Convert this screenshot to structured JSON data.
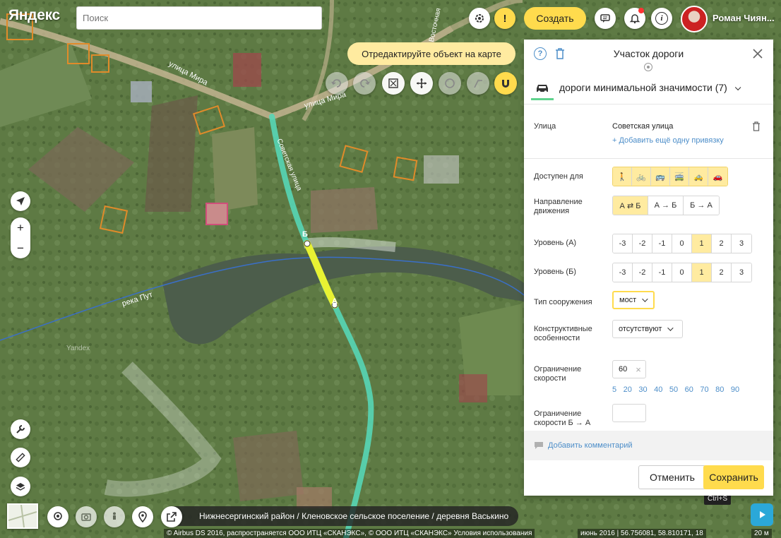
{
  "brand": {
    "logo": "Яндекс"
  },
  "search": {
    "placeholder": "Поиск"
  },
  "header": {
    "create_label": "Создать",
    "user_name": "Роман Чиян..."
  },
  "map": {
    "edit_tip": "Отредактируйте объект на карте",
    "labels": {
      "street_mira": "улица Мира",
      "street_mira2": "улица Мира",
      "sovetskaya": "Советская улица",
      "river": "река Пут",
      "yandex_wm": "Yandex",
      "vost": "Восточная"
    },
    "point_b": "Б",
    "point_a": "А",
    "breadcrumb": "Нижнесергинский район / Кленовское сельское поселение / деревня Васькино",
    "copyright": "© Airbus DS 2016, распространяется ООО ИТЦ «СКАНЭКС», © ООО ИТЦ «СКАНЭКС» Условия использования",
    "coords": "июнь 2016 | 56.756081, 58.810171, 18",
    "scale": "20 м",
    "save_shortcut": "Ctrl+S"
  },
  "panel": {
    "title": "Участок дороги",
    "category": "дороги минимальной значимости (7)",
    "street_label": "Улица",
    "street_value": "Советская улица",
    "add_binding": "+ Добавить ещё одну привязку",
    "access_label": "Доступен для",
    "access_modes": [
      "pedestrian-icon",
      "bicycle-icon",
      "bus-icon",
      "trolleybus-icon",
      "taxi-icon",
      "car-icon"
    ],
    "direction_label": "Направление движения",
    "direction_options": [
      "А ⇄ Б",
      "А → Б",
      "Б → А"
    ],
    "direction_selected": 0,
    "level_a_label": "Уровень (А)",
    "level_b_label": "Уровень (Б)",
    "levels": [
      "-3",
      "-2",
      "-1",
      "0",
      "1",
      "2",
      "3"
    ],
    "level_a_selected": 4,
    "level_b_selected": 4,
    "structure_label": "Тип сооружения",
    "structure_value": "мост",
    "constructive_label": "Конструктивные особенности",
    "constructive_value": "отсутствуют",
    "speed_label": "Ограничение скорости",
    "speed_value": "60",
    "speed_options": [
      "5",
      "20",
      "30",
      "40",
      "50",
      "60",
      "70",
      "80",
      "90"
    ],
    "speed_ba_label": "Ограничение скорости Б → А",
    "speed_ba_value": "",
    "add_comment": "Добавить комментарий",
    "cancel_label": "Отменить",
    "save_label": "Сохранить"
  }
}
